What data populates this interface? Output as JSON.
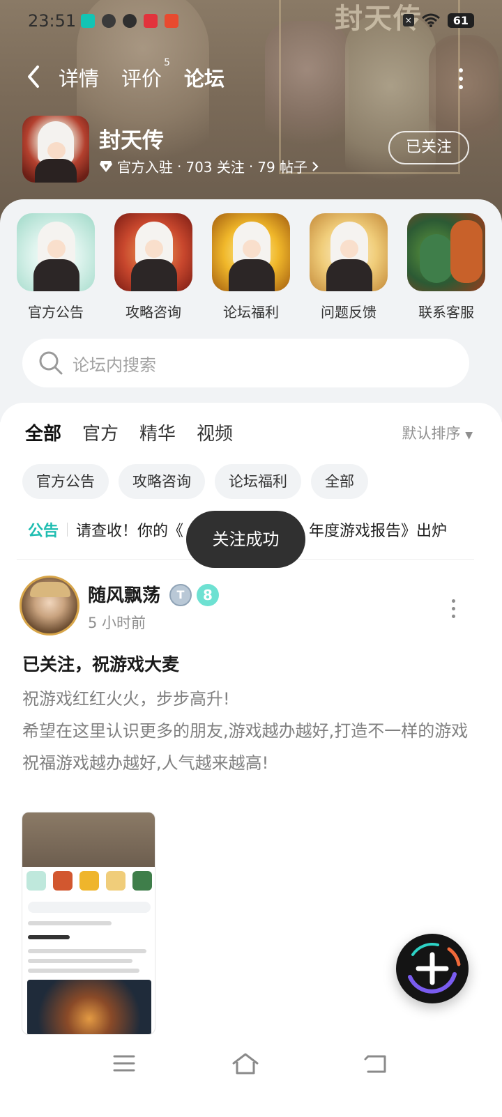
{
  "status_bar": {
    "time": "23:51",
    "battery": "61",
    "app_icons": [
      "top-app-icon",
      "shield-icon",
      "bird-icon",
      "red-app-icon",
      "red-bag-icon"
    ]
  },
  "banner_title": "封天传",
  "nav": {
    "tabs": [
      {
        "label": "详情"
      },
      {
        "label": "评价",
        "badge": "5"
      },
      {
        "label": "论坛"
      }
    ]
  },
  "game": {
    "name": "封天传",
    "verified": "官方入驻",
    "followers": "703 关注",
    "posts": "79 帖子",
    "follow_button": "已关注"
  },
  "shortcuts": [
    {
      "label": "官方公告"
    },
    {
      "label": "攻略咨询"
    },
    {
      "label": "论坛福利"
    },
    {
      "label": "问题反馈"
    },
    {
      "label": "联系客服"
    }
  ],
  "search": {
    "placeholder": "论坛内搜索"
  },
  "feed_tabs": [
    {
      "label": "全部"
    },
    {
      "label": "官方"
    },
    {
      "label": "精华"
    },
    {
      "label": "视频"
    }
  ],
  "sort_label": "默认排序",
  "chips": [
    "官方公告",
    "攻略咨询",
    "论坛福利",
    "全部"
  ],
  "notice": {
    "tag": "公告",
    "text_left": "请查收！你的《",
    "text_right": "年度游戏报告》出炉"
  },
  "toast": "关注成功",
  "post": {
    "user": "随风飘荡",
    "badge_level": "8",
    "time": "5 小时前",
    "title": "已关注，祝游戏大麦",
    "body": [
      "祝游戏红红火火，步步高升!",
      "希望在这里认识更多的朋友,游戏越办越好,打造不一样的游戏",
      "祝福游戏越办越好,人气越来越高!"
    ]
  },
  "colors": {
    "accent": "#2dd3c6",
    "notice_tag": "#1fbdb1",
    "toast_bg": "#303030"
  }
}
